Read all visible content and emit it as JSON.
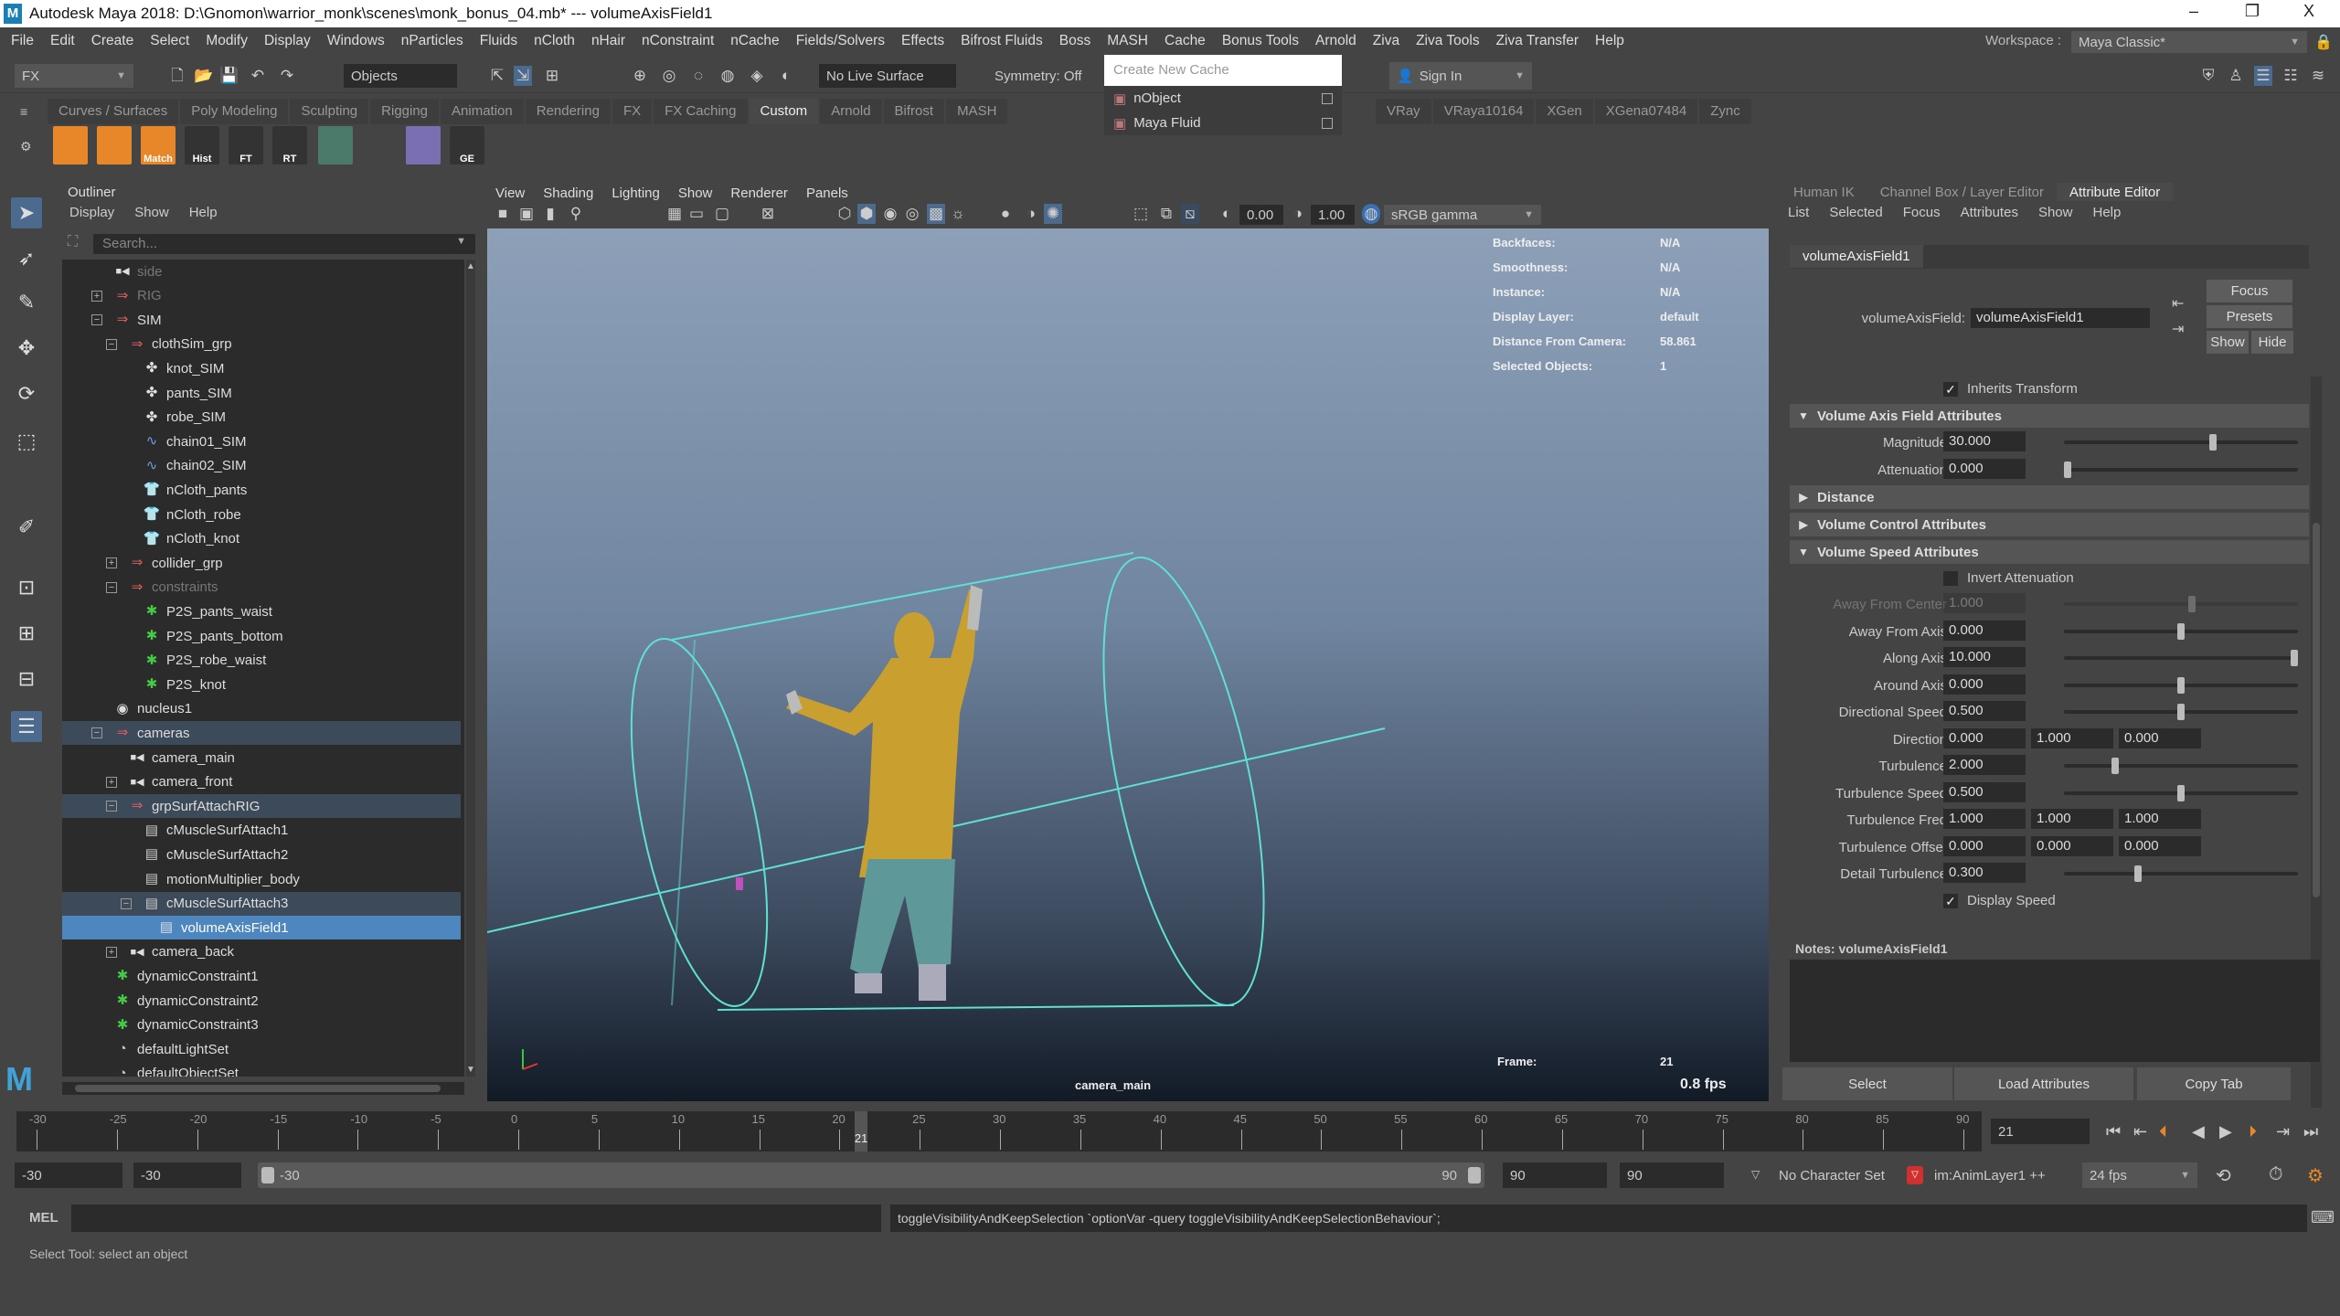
{
  "window": {
    "title": "Autodesk Maya 2018: D:\\Gnomon\\warrior_monk\\scenes\\monk_bonus_04.mb*  ---  volumeAxisField1",
    "minimize": "–",
    "restore": "❐",
    "close": "X"
  },
  "menubar": [
    "File",
    "Edit",
    "Create",
    "Select",
    "Modify",
    "Display",
    "Windows",
    "nParticles",
    "Fluids",
    "nCloth",
    "nHair",
    "nConstraint",
    "nCache",
    "Fields/Solvers",
    "Effects",
    "Bifrost Fluids",
    "Boss",
    "MASH",
    "Cache",
    "Bonus Tools",
    "Arnold",
    "Ziva",
    "Ziva Tools",
    "Ziva Transfer",
    "Help"
  ],
  "workspace": {
    "label": "Workspace :",
    "value": "Maya Classic*"
  },
  "statusline": {
    "menuset": "FX",
    "selection_mode": "Objects",
    "live_surface": "No Live Surface",
    "symmetry": "Symmetry: Off",
    "cache_placeholder": "Create New Cache",
    "sign_in": "Sign In"
  },
  "cache_popup": [
    {
      "label": "nObject"
    },
    {
      "label": "Maya Fluid"
    }
  ],
  "shelf_tabs": [
    "Curves / Surfaces",
    "Poly Modeling",
    "Sculpting",
    "Rigging",
    "Animation",
    "Rendering",
    "FX",
    "FX Caching",
    "Custom",
    "Arnold",
    "Bifrost",
    "MASH"
  ],
  "shelf_tabs_right": [
    "VRay",
    "VRaya10164",
    "XGen",
    "XGena07484",
    "Zync"
  ],
  "shelf_active": "Custom",
  "shelf_icons": [
    {
      "label": "",
      "color": "#e8862a"
    },
    {
      "label": "",
      "color": "#e8862a"
    },
    {
      "label": "Match",
      "color": "#e8862a"
    },
    {
      "label": "Hist",
      "color": "#333"
    },
    {
      "label": "FT",
      "color": "#333"
    },
    {
      "label": "RT",
      "color": "#333"
    },
    {
      "label": "",
      "color": "#4c7a6a"
    },
    {
      "label": "",
      "color": "#444"
    },
    {
      "label": "",
      "color": "#7a6fb0"
    },
    {
      "label": "GE",
      "color": "#333"
    }
  ],
  "outliner": {
    "title": "Outliner",
    "menu": [
      "Display",
      "Show",
      "Help"
    ],
    "search_placeholder": "Search...",
    "rows": [
      {
        "label": "side",
        "icon": "camera",
        "depth": 0,
        "state": "dim"
      },
      {
        "label": "RIG",
        "icon": "group",
        "depth": 0,
        "expander": "+",
        "state": "dim"
      },
      {
        "label": "SIM",
        "icon": "group",
        "depth": 0,
        "expander": "-"
      },
      {
        "label": "clothSim_grp",
        "icon": "group",
        "depth": 1,
        "expander": "-"
      },
      {
        "label": "knot_SIM",
        "icon": "mesh",
        "depth": 2
      },
      {
        "label": "pants_SIM",
        "icon": "mesh",
        "depth": 2
      },
      {
        "label": "robe_SIM",
        "icon": "mesh",
        "depth": 2
      },
      {
        "label": "chain01_SIM",
        "icon": "curve",
        "depth": 2
      },
      {
        "label": "chain02_SIM",
        "icon": "curve",
        "depth": 2
      },
      {
        "label": "nCloth_pants",
        "icon": "ncloth",
        "depth": 2
      },
      {
        "label": "nCloth_robe",
        "icon": "ncloth",
        "depth": 2
      },
      {
        "label": "nCloth_knot",
        "icon": "ncloth",
        "depth": 2
      },
      {
        "label": "collider_grp",
        "icon": "group",
        "depth": 1,
        "expander": "+"
      },
      {
        "label": "constraints",
        "icon": "group",
        "depth": 1,
        "expander": "-",
        "state": "dim"
      },
      {
        "label": "P2S_pants_waist",
        "icon": "constraint",
        "depth": 2
      },
      {
        "label": "P2S_pants_bottom",
        "icon": "constraint",
        "depth": 2
      },
      {
        "label": "P2S_robe_waist",
        "icon": "constraint",
        "depth": 2
      },
      {
        "label": "P2S_knot",
        "icon": "constraint",
        "depth": 2
      },
      {
        "label": "nucleus1",
        "icon": "nucleus",
        "depth": 0
      },
      {
        "label": "cameras",
        "icon": "group",
        "depth": 0,
        "expander": "-",
        "state": "hl"
      },
      {
        "label": "camera_main",
        "icon": "camera",
        "depth": 1
      },
      {
        "label": "camera_front",
        "icon": "camera",
        "depth": 1,
        "expander": "+"
      },
      {
        "label": "grpSurfAttachRIG",
        "icon": "group",
        "depth": 1,
        "expander": "-",
        "state": "hl"
      },
      {
        "label": "cMuscleSurfAttach1",
        "icon": "muscle",
        "depth": 2
      },
      {
        "label": "cMuscleSurfAttach2",
        "icon": "muscle",
        "depth": 2
      },
      {
        "label": "motionMultiplier_body",
        "icon": "muscle",
        "depth": 2
      },
      {
        "label": "cMuscleSurfAttach3",
        "icon": "muscle",
        "depth": 2,
        "expander": "-",
        "state": "hl"
      },
      {
        "label": "volumeAxisField1",
        "icon": "field",
        "depth": 3,
        "state": "sel"
      },
      {
        "label": "camera_back",
        "icon": "camera",
        "depth": 1,
        "expander": "+"
      },
      {
        "label": "dynamicConstraint1",
        "icon": "constraint",
        "depth": 0
      },
      {
        "label": "dynamicConstraint2",
        "icon": "constraint",
        "depth": 0
      },
      {
        "label": "dynamicConstraint3",
        "icon": "constraint",
        "depth": 0
      },
      {
        "label": "defaultLightSet",
        "icon": "set",
        "depth": 0
      },
      {
        "label": "defaultObjectSet",
        "icon": "set",
        "depth": 0
      }
    ]
  },
  "viewport": {
    "menu": [
      "View",
      "Shading",
      "Lighting",
      "Show",
      "Renderer",
      "Panels"
    ],
    "exposure": "0.00",
    "gamma": "1.00",
    "color_space": "sRGB gamma",
    "hud": [
      {
        "label": "Backfaces:",
        "value": "N/A"
      },
      {
        "label": "Smoothness:",
        "value": "N/A"
      },
      {
        "label": "Instance:",
        "value": "N/A"
      },
      {
        "label": "Display Layer:",
        "value": "default"
      },
      {
        "label": "Distance From Camera:",
        "value": "58.861"
      },
      {
        "label": "Selected Objects:",
        "value": "1"
      }
    ],
    "camera": "camera_main",
    "frame_label": "Frame:",
    "frame": "21",
    "fps": "0.8 fps"
  },
  "attribute_editor": {
    "tabs": [
      "Human IK",
      "Channel Box / Layer Editor",
      "Attribute Editor"
    ],
    "active_tab": "Attribute Editor",
    "menu": [
      "List",
      "Selected",
      "Focus",
      "Attributes",
      "Show",
      "Help"
    ],
    "node_tab": "volumeAxisField1",
    "node_label": "volumeAxisField:",
    "node_value": "volumeAxisField1",
    "buttons": {
      "focus": "Focus",
      "presets": "Presets",
      "show": "Show",
      "hide": "Hide"
    },
    "rows": [
      {
        "type": "check",
        "label": "Inherits Transform",
        "checked": true
      },
      {
        "type": "section",
        "label": "Volume Axis Field Attributes",
        "open": true
      },
      {
        "type": "slider",
        "label": "Magnitude",
        "value": "30.000",
        "level": 0.64
      },
      {
        "type": "slider",
        "label": "Attenuation",
        "value": "0.000",
        "level": 0.0
      },
      {
        "type": "section",
        "label": "Distance",
        "open": false
      },
      {
        "type": "section",
        "label": "Volume Control Attributes",
        "open": false
      },
      {
        "type": "section",
        "label": "Volume Speed Attributes",
        "open": true
      },
      {
        "type": "check",
        "label": "Invert Attenuation",
        "checked": false
      },
      {
        "type": "slider",
        "label": "Away From Center",
        "value": "1.000",
        "level": 0.55,
        "disabled": true
      },
      {
        "type": "slider",
        "label": "Away From Axis",
        "value": "0.000",
        "level": 0.5
      },
      {
        "type": "slider",
        "label": "Along Axis",
        "value": "10.000",
        "level": 1.0
      },
      {
        "type": "slider",
        "label": "Around Axis",
        "value": "0.000",
        "level": 0.5
      },
      {
        "type": "slider",
        "label": "Directional Speed",
        "value": "0.500",
        "level": 0.5
      },
      {
        "type": "vector",
        "label": "Direction",
        "values": [
          "0.000",
          "1.000",
          "0.000"
        ]
      },
      {
        "type": "slider",
        "label": "Turbulence",
        "value": "2.000",
        "level": 0.21
      },
      {
        "type": "slider",
        "label": "Turbulence Speed",
        "value": "0.500",
        "level": 0.5
      },
      {
        "type": "vector",
        "label": "Turbulence Freq",
        "values": [
          "1.000",
          "1.000",
          "1.000"
        ]
      },
      {
        "type": "vector",
        "label": "Turbulence Offset",
        "values": [
          "0.000",
          "0.000",
          "0.000"
        ]
      },
      {
        "type": "slider",
        "label": "Detail Turbulence",
        "value": "0.300",
        "level": 0.31
      },
      {
        "type": "check",
        "label": "Display Speed",
        "checked": true
      }
    ],
    "notes_label": "Notes:  volumeAxisField1",
    "bottom_buttons": [
      "Select",
      "Load Attributes",
      "Copy Tab"
    ]
  },
  "timeline": {
    "start": -30,
    "end": 90,
    "step": 5,
    "current": "21"
  },
  "range": {
    "anim_start": "-30",
    "play_start": "-30",
    "slider_start": "-30",
    "slider_end": "90",
    "play_end": "90",
    "anim_end": "90",
    "character_set": "No Character Set",
    "anim_layer": "im:AnimLayer1 ++",
    "fps": "24 fps"
  },
  "command_line": {
    "language": "MEL",
    "input": "",
    "output": "toggleVisibilityAndKeepSelection `optionVar -query toggleVisibilityAndKeepSelectionBehaviour`;"
  },
  "help_line": "Select Tool: select an object",
  "colors": {
    "selection": "#4e86c0",
    "highlight_row": "#3d4a59",
    "panel": "#444444",
    "field": "#2b2b2b",
    "wireframe": "#5fe0d0",
    "robe": "#c9a030",
    "pants": "#5e9898"
  }
}
